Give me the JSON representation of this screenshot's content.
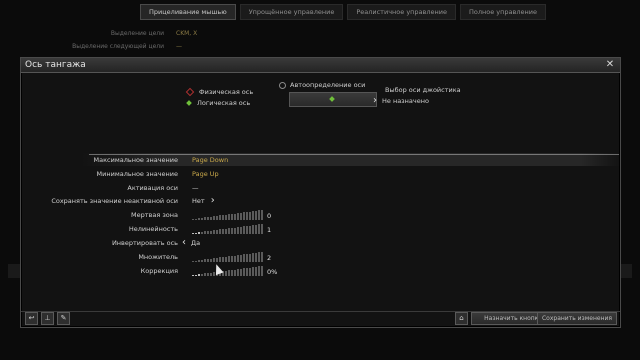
{
  "background": {
    "tabs": [
      {
        "label": "Прицеливание мышью",
        "active": true
      },
      {
        "label": "Упрощённое управление",
        "active": false
      },
      {
        "label": "Реалистичное управление",
        "active": false
      },
      {
        "label": "Полное управление",
        "active": false
      }
    ],
    "rows": [
      {
        "label": "Выделение цели",
        "value": "CKM, X"
      },
      {
        "label": "Выделение следующей цели",
        "value": "—"
      }
    ]
  },
  "dialog": {
    "title": "Ось тангажа",
    "close_icon": "close-icon",
    "axis": {
      "physical_label": "Физическая ось",
      "logical_label": "Логическая ось",
      "auto_detect_label": "Автоопределение оси",
      "joystick_title": "Выбор оси джойстика",
      "joystick_value": "Не назначено"
    },
    "settings": {
      "max_value": {
        "label": "Максимальное значение",
        "value": "Page Down"
      },
      "min_value": {
        "label": "Минимальное значение",
        "value": "Page Up"
      },
      "activation": {
        "label": "Активация оси",
        "value": "—"
      },
      "keep_value": {
        "label": "Сохранять значение неактивной оси",
        "value": "Нет"
      },
      "deadzone": {
        "label": "Мертвая зона",
        "value": "0",
        "level": 0
      },
      "nonlinearity": {
        "label": "Нелинейность",
        "value": "1",
        "level": 0.1
      },
      "invert": {
        "label": "Инвертировать ось",
        "value": "Да"
      },
      "multiplier": {
        "label": "Множитель",
        "value": "2",
        "level": 0.0
      },
      "correction": {
        "label": "Коррекция",
        "value": "0%",
        "level": 0.1
      }
    },
    "footer": {
      "assign_button": "Назначить кнопку",
      "save_button": "Сохранить изменения"
    }
  }
}
